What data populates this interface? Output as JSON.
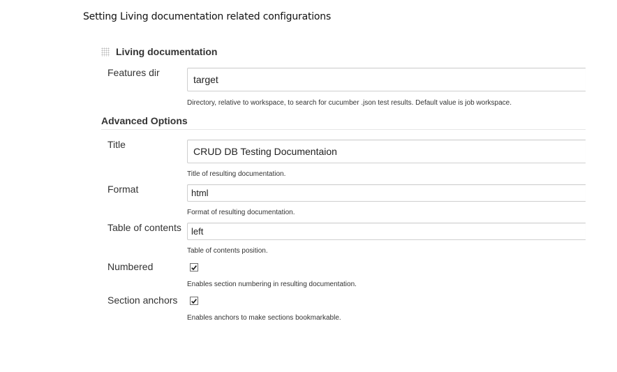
{
  "caption": "Setting Living documentation related configurations",
  "section": {
    "title": "Living documentation",
    "grip_icon": "drag-handle-icon"
  },
  "features_dir": {
    "label": "Features dir",
    "value": "target",
    "hint": "Directory, relative to workspace, to search for cucumber .json test results. Default value is job workspace."
  },
  "advanced": {
    "title": "Advanced Options"
  },
  "title_field": {
    "label": "Title",
    "value": "CRUD DB Testing Documentaion",
    "hint": "Title of resulting documentation."
  },
  "format_field": {
    "label": "Format",
    "value": "html",
    "hint": "Format of resulting documentation."
  },
  "toc_field": {
    "label": "Table of contents",
    "value": "left",
    "hint": "Table of contents position."
  },
  "numbered": {
    "label": "Numbered",
    "checked": true,
    "hint": "Enables section numbering in resulting documentation."
  },
  "section_anchors": {
    "label": "Section anchors",
    "checked": true,
    "hint": "Enables anchors to make sections bookmarkable."
  }
}
